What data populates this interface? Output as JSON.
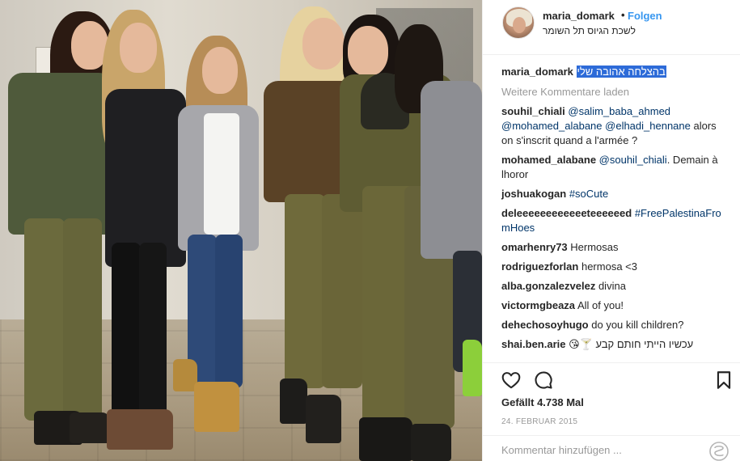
{
  "post": {
    "username": "maria_domark",
    "separator": "•",
    "follow_label": "Folgen",
    "location": "לשכת הגיוס תל השומר",
    "caption": "בהצלחה אהובה שלי",
    "load_more_label": "Weitere Kommentare laden",
    "likes_text": "Gefällt 4.738 Mal",
    "date": "24. FEBRUAR 2015",
    "comment_placeholder": "Kommentar hinzufügen ...",
    "accent_color": "#3897f0",
    "highlight_color": "#2d6bd8"
  },
  "comments": [
    {
      "user": "souhil_chiali",
      "mention1": "@salim_baba_ahmed",
      "mention2": "@mohamed_alabane",
      "mention3": "@elhadi_hennane",
      "text": "alors on s'inscrit quand a l'armée ?"
    },
    {
      "user": "mohamed_alabane",
      "mention": "@souhil_chiali",
      "text": ". Demain à lhoror"
    },
    {
      "user": "joshuakogan",
      "tag": "#soCute"
    },
    {
      "user": "deleeeeeeeeeeeeteeeeeed",
      "tag": "#FreePalestinaFromHoes"
    },
    {
      "user": "omarhenry73",
      "text": "Hermosas"
    },
    {
      "user": "rodriguezforlan",
      "text": "hermosa <3"
    },
    {
      "user": "alba.gonzalezvelez",
      "text": "divina"
    },
    {
      "user": "victormgbeaza",
      "text": "All of you!"
    },
    {
      "user": "dehechosoyhugo",
      "text": "do you kill children?"
    },
    {
      "user": "shai.ben.arie",
      "text": "עכשיו הייתי חותם קבע 🍸😘"
    }
  ],
  "icons": {
    "like": "heart-icon",
    "comment": "comment-bubble-icon",
    "save": "bookmark-icon",
    "more": "options-icon"
  }
}
